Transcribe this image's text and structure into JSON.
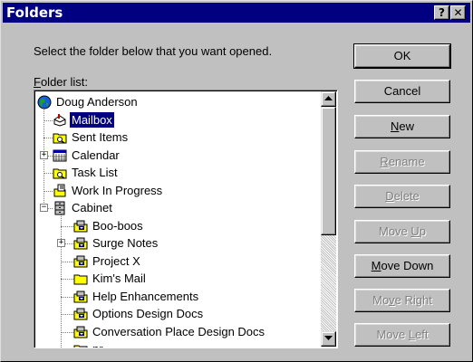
{
  "dialog": {
    "title": "Folders",
    "help_glyph": "?",
    "close_glyph": "✕",
    "instruction": "Select the folder below that you want opened.",
    "list_label_accel": "F",
    "list_label_rest": "older list:"
  },
  "tree": [
    {
      "label": "Doug Anderson",
      "icon": "globe-icon",
      "level": 0,
      "expander": null,
      "selected": false
    },
    {
      "label": "Mailbox",
      "icon": "mailbox-icon",
      "level": 1,
      "expander": null,
      "selected": true
    },
    {
      "label": "Sent Items",
      "icon": "sent-items-folder-icon",
      "level": 1,
      "expander": null,
      "selected": false
    },
    {
      "label": "Calendar",
      "icon": "calendar-icon",
      "level": 1,
      "expander": "+",
      "selected": false
    },
    {
      "label": "Task List",
      "icon": "task-list-folder-icon",
      "level": 1,
      "expander": null,
      "selected": false
    },
    {
      "label": "Work In Progress",
      "icon": "work-in-progress-icon",
      "level": 1,
      "expander": null,
      "selected": false
    },
    {
      "label": "Cabinet",
      "icon": "cabinet-icon",
      "level": 1,
      "expander": "-",
      "selected": false
    },
    {
      "label": "Boo-boos",
      "icon": "shared-folder-icon",
      "level": 2,
      "expander": null,
      "selected": false
    },
    {
      "label": "Surge Notes",
      "icon": "shared-folder-icon",
      "level": 2,
      "expander": "+",
      "selected": false
    },
    {
      "label": "Project X",
      "icon": "shared-folder-icon",
      "level": 2,
      "expander": null,
      "selected": false
    },
    {
      "label": "Kim's Mail",
      "icon": "folder-icon",
      "level": 2,
      "expander": null,
      "selected": false
    },
    {
      "label": "Help Enhancements",
      "icon": "shared-folder-icon",
      "level": 2,
      "expander": null,
      "selected": false
    },
    {
      "label": "Options Design Docs",
      "icon": "shared-folder-icon",
      "level": 2,
      "expander": null,
      "selected": false
    },
    {
      "label": "Conversation Place Design Docs",
      "icon": "shared-folder-icon",
      "level": 2,
      "expander": null,
      "selected": false
    },
    {
      "label": "nr",
      "icon": "folder-icon",
      "level": 2,
      "expander": null,
      "selected": false
    }
  ],
  "buttons": [
    {
      "id": "ok",
      "label": "OK",
      "accel_index": -1,
      "enabled": true,
      "default": true
    },
    {
      "id": "cancel",
      "label": "Cancel",
      "accel_index": -1,
      "enabled": true,
      "default": false
    },
    {
      "id": "new",
      "label": "New",
      "accel_index": 0,
      "enabled": true,
      "default": false
    },
    {
      "id": "rename",
      "label": "Rename",
      "accel_index": 0,
      "enabled": false,
      "default": false
    },
    {
      "id": "delete",
      "label": "Delete",
      "accel_index": 0,
      "enabled": false,
      "default": false
    },
    {
      "id": "move-up",
      "label": "Move Up",
      "accel_index": 5,
      "enabled": false,
      "default": false
    },
    {
      "id": "move-down",
      "label": "Move Down",
      "accel_index": 0,
      "enabled": true,
      "default": false
    },
    {
      "id": "move-right",
      "label": "Move Right",
      "accel_index": 2,
      "enabled": false,
      "default": false
    },
    {
      "id": "move-left",
      "label": "Move Left",
      "accel_index": 5,
      "enabled": false,
      "default": false
    }
  ],
  "colors": {
    "titlebar": "#000080",
    "face": "#c0c0c0",
    "selection": "#000080",
    "folder": "#ffff00",
    "disabled_text": "#808080"
  }
}
